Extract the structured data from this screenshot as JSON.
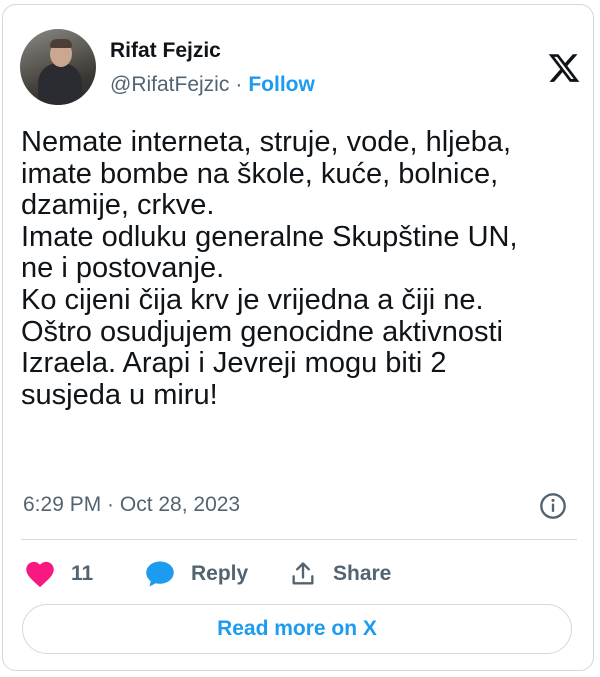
{
  "author": {
    "name": "Rifat Fejzic",
    "handle": "@RifatFejzic",
    "separator": "·",
    "follow_label": "Follow"
  },
  "tweet": {
    "text": "Nemate interneta, struje, vode, hljeba,\nimate bombe na škole, kuće, bolnice,\ndzamije, crkve.\nImate odluku generalne Skupštine UN,\nne i postovanje.\nKo cijeni čija krv je vrijedna a čiji ne.\nOštro osudjujem genocidne aktivnosti\nIzraela. Arapi i Jevreji mogu biti 2\nsusjeda u miru!",
    "timestamp": "6:29 PM · Oct 28, 2023"
  },
  "actions": {
    "like_count": "11",
    "reply_label": "Reply",
    "share_label": "Share"
  },
  "read_more_label": "Read more on X",
  "icons": {
    "platform": "x-logo-icon",
    "info": "info-icon",
    "like": "heart-icon",
    "reply": "speech-bubble-icon",
    "share": "share-arrow-icon"
  },
  "colors": {
    "accent": "#1d9bf0",
    "like": "#f91880",
    "text": "#0f1419",
    "muted": "#536471",
    "border": "#cfd9de"
  }
}
